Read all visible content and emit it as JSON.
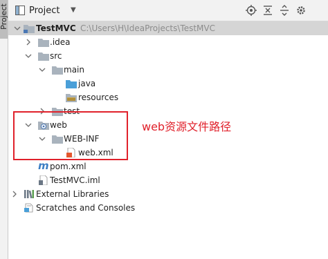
{
  "toolwindow": {
    "strip_label": "Project",
    "title": "Project",
    "dropdown_icon": "caret-down-icon",
    "tools": [
      "locate-icon",
      "collapse-all-icon",
      "expand-all-icon",
      "settings-icon"
    ]
  },
  "tree": {
    "root": {
      "name": "TestMVC",
      "path": "C:\\Users\\H\\IdeaProjects\\TestMVC"
    },
    "idea": "idea",
    "src": "src",
    "main": "main",
    "java": "java",
    "resources": "resources",
    "test": "test",
    "web": "web",
    "webinf": "WEB-INF",
    "webxml": "web.xml",
    "pom": "pom.xml",
    "iml": "TestMVC.iml",
    "ext": "External Libraries",
    "scratches": "Scratches and Consoles"
  },
  "annotation": {
    "text": "web资源文件路径",
    "color": "#e0202a"
  },
  "colors": {
    "folder": "#a9b3bd",
    "source_folder": "#4a9fd8",
    "highlight": "#e0202a"
  }
}
